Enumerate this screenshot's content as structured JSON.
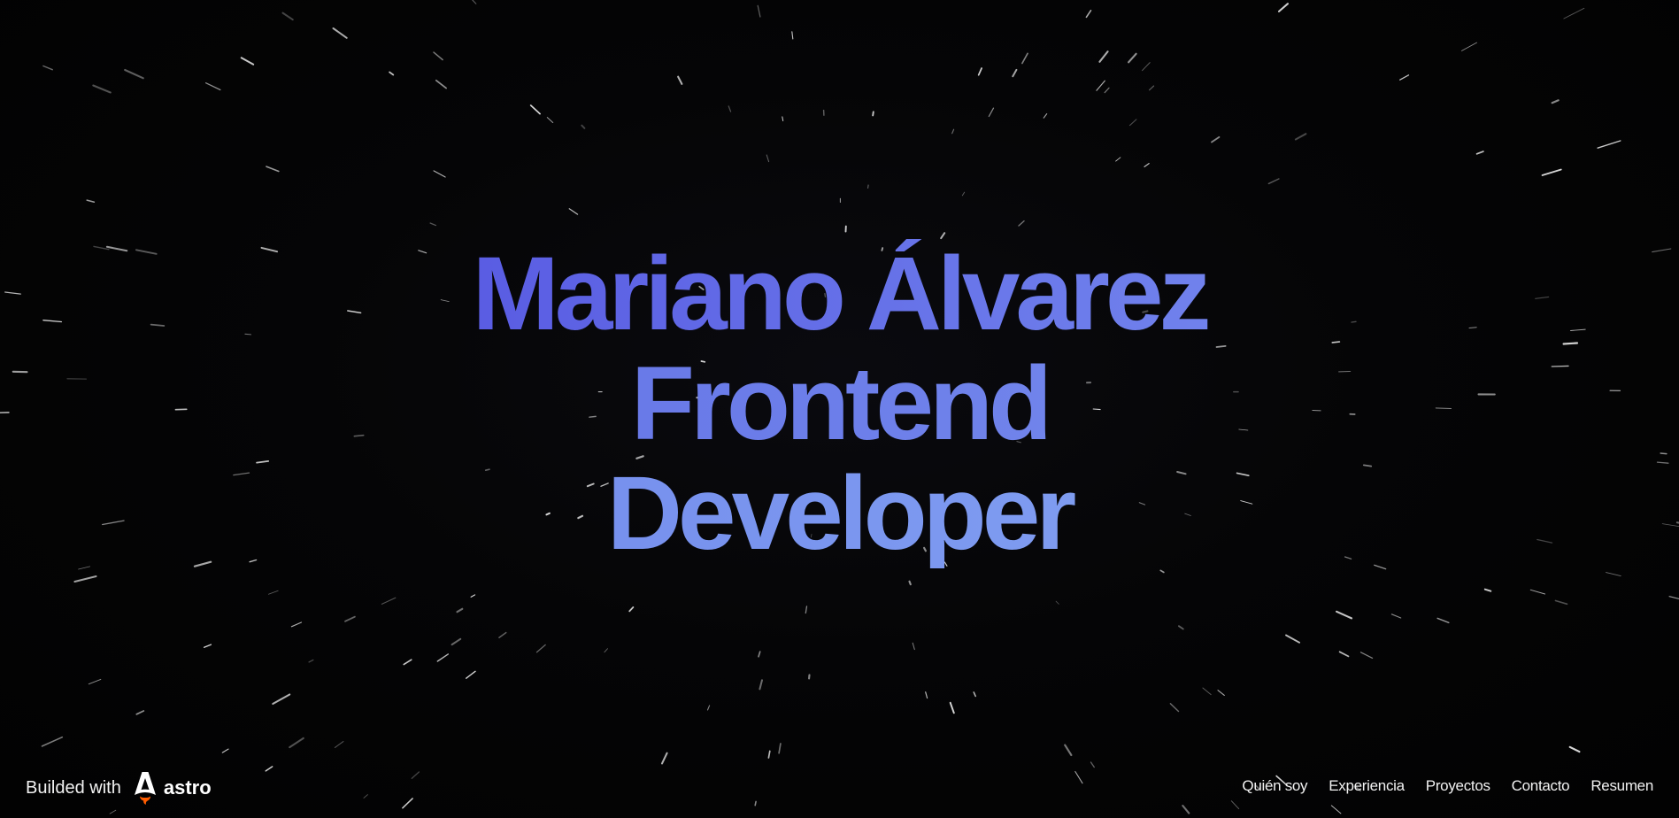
{
  "hero": {
    "name": "Mariano Álvarez",
    "role_line_1": "Frontend",
    "role_line_2": "Developer"
  },
  "footer": {
    "built_label": "Builded with",
    "framework_name": "astro"
  },
  "nav": {
    "items": [
      {
        "label": "Quién soy"
      },
      {
        "label": "Experiencia"
      },
      {
        "label": "Proyectos"
      },
      {
        "label": "Contacto"
      },
      {
        "label": "Resumen"
      }
    ]
  },
  "colors": {
    "background": "#030303",
    "heading_gradient_start": "#4b44dc",
    "heading_gradient_end": "#88aaf4",
    "astro_accent": "#ff5d01",
    "text": "#f2f2f2"
  },
  "icons": {
    "logo": "astro-logo-icon"
  }
}
